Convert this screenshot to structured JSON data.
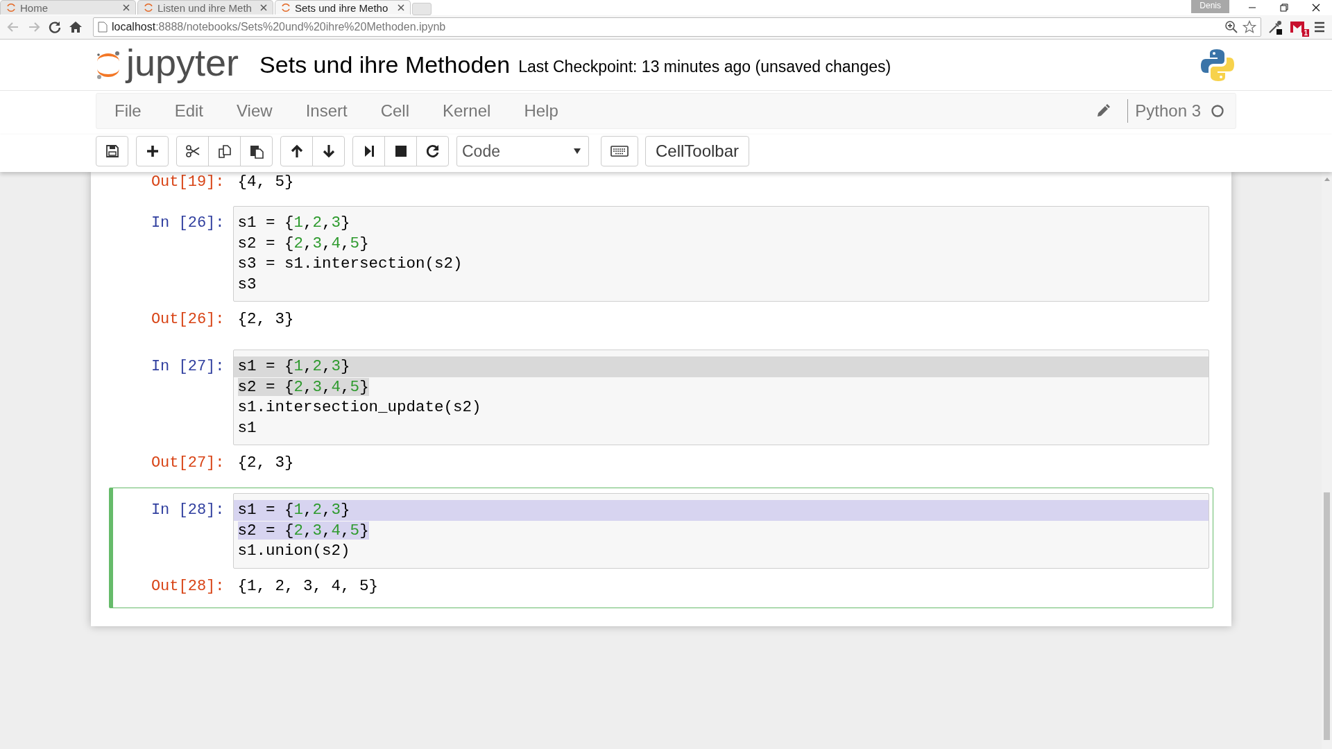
{
  "browser": {
    "tabs": [
      {
        "title": "Home",
        "selected": false
      },
      {
        "title": "Listen und ihre Meth",
        "selected": false
      },
      {
        "title": "Sets und ihre Metho",
        "selected": true
      }
    ],
    "profile": "Denis",
    "address": {
      "host": "localhost",
      "path": ":8888/notebooks/Sets%20und%20ihre%20Methoden.ipynb"
    },
    "mail_badge": "1"
  },
  "header": {
    "logo": "jupyter",
    "title": "Sets und ihre Methoden",
    "checkpoint": "Last Checkpoint: 13 minutes ago (unsaved changes)"
  },
  "menu": [
    "File",
    "Edit",
    "View",
    "Insert",
    "Cell",
    "Kernel",
    "Help"
  ],
  "kernel": {
    "name": "Python 3",
    "busy": false
  },
  "toolbar": {
    "groups": [
      [
        {
          "kind": "save"
        }
      ],
      [
        {
          "kind": "add"
        }
      ],
      [
        {
          "kind": "cut"
        },
        {
          "kind": "copy"
        },
        {
          "kind": "paste"
        }
      ],
      [
        {
          "kind": "up"
        },
        {
          "kind": "down"
        }
      ],
      [
        {
          "kind": "run"
        },
        {
          "kind": "stop"
        },
        {
          "kind": "restart"
        }
      ]
    ],
    "cell_type": "Code",
    "cell_toolbar": "CellToolbar"
  },
  "cells": [
    {
      "selected": false,
      "out_prompt": "Out[19]:",
      "output": "{4, 5}"
    },
    {
      "selected": false,
      "in_prompt": "In [26]:",
      "lines": [
        {
          "text": "s1 = {1,2,3}",
          "selected": false
        },
        {
          "text": "s2 = {2,3,4,5}",
          "selected": false
        },
        {
          "text": "s3 = s1.intersection(s2)",
          "selected": false
        },
        {
          "text": "s3",
          "selected": false
        }
      ],
      "out_prompt": "Out[26]:",
      "output": "{2, 3}"
    },
    {
      "selected": false,
      "in_prompt": "In [27]:",
      "lines": [
        {
          "text": "s1 = {1,2,3}",
          "selected": true
        },
        {
          "text": "s2 = {2,3,4,5}",
          "selected": true
        },
        {
          "text": "s1.intersection_update(s2)",
          "selected": false
        },
        {
          "text": "s1",
          "selected": false
        }
      ],
      "out_prompt": "Out[27]:",
      "output": "{2, 3}"
    },
    {
      "selected": true,
      "in_prompt": "In [28]:",
      "lines": [
        {
          "text": "s1 = {1,2,3}",
          "selected": true
        },
        {
          "text": "s2 = {2,3,4,5}",
          "selected": true
        },
        {
          "text": "s1.union(s2)",
          "selected": false
        }
      ],
      "out_prompt": "Out[28]:",
      "output": "{1, 2, 3, 4, 5}"
    }
  ]
}
